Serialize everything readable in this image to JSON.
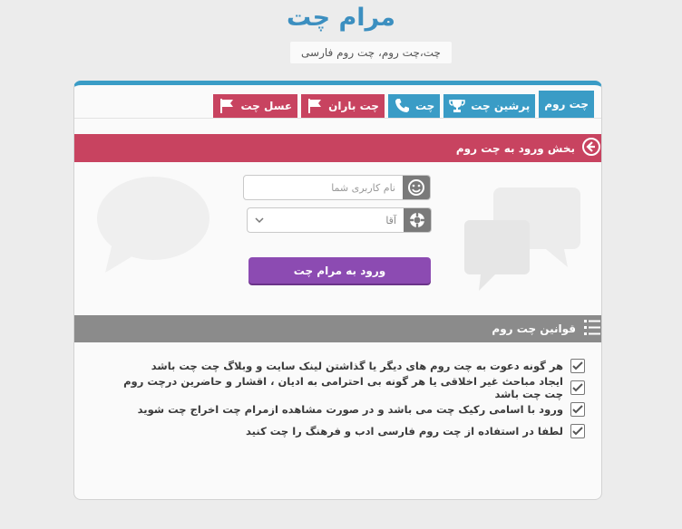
{
  "header": {
    "title": "مرام چت",
    "subtitle": "چت،چت روم، چت روم فارسی"
  },
  "nav": {
    "tabs": [
      {
        "label": "چت روم",
        "color": "#3a9cc6",
        "icon": "none",
        "active": true
      },
      {
        "label": "پرشین چت",
        "color": "#3a9cc6",
        "icon": "trophy-icon"
      },
      {
        "label": "چت",
        "color": "#3a9cc6",
        "icon": "phone-icon"
      },
      {
        "label": "چت باران",
        "color": "#c84360",
        "icon": "flag-icon"
      },
      {
        "label": "عسل چت",
        "color": "#c84360",
        "icon": "flag-icon"
      }
    ]
  },
  "login": {
    "section_title": "بخش ورود به چت روم",
    "username_placeholder": "نام کاربری شما",
    "gender_selected": "آقا",
    "submit_label": "ورود به مرام چت"
  },
  "rules": {
    "section_title": "قوانین چت روم",
    "items": [
      "هر گونه دعوت به چت روم های دیگر یا گذاشتن لینک سایت و وبلاگ چت چت باشد",
      "ایجاد مباحث غیر اخلاقی یا هر گونه بی احترامی به ادیان ، اقشار و حاضرین درچت روم چت چت باشد",
      "ورود با اسامی رکیک چت می باشد و در صورت مشاهده ازمرام چت اخراج چت شوید",
      "لطفا در استفاده از چت روم فارسی ادب و فرهنگ را چت کنید"
    ]
  },
  "colors": {
    "accent": "#3a9cc6",
    "login_bar": "#c84360",
    "submit": "#8c4bb2",
    "rules_bar": "#8b8b8b"
  }
}
